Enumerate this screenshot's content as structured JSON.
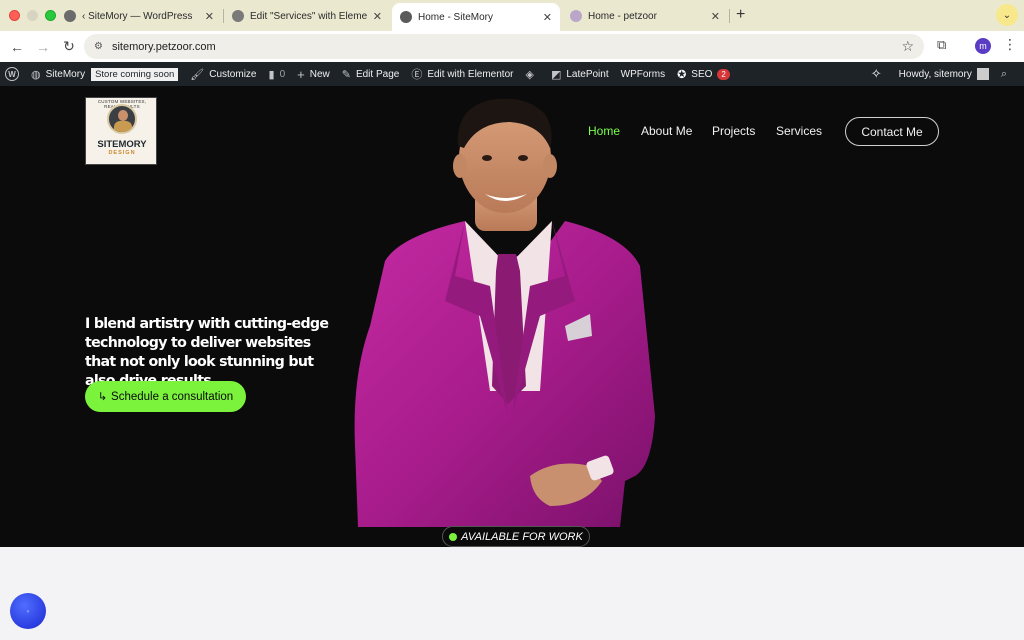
{
  "browser": {
    "tabs": [
      {
        "title": "‹ SiteMory — WordPress",
        "active": false
      },
      {
        "title": "Edit \"Services\" with Elemento",
        "active": false
      },
      {
        "title": "Home - SiteMory",
        "active": true
      },
      {
        "title": "Home - petzoor",
        "active": false
      }
    ],
    "new_tab": "+",
    "tab_menu_icon": "chevron-down-icon",
    "url": "sitemory.petzoor.com",
    "profile_initial": "m"
  },
  "wpbar": {
    "logo": "W",
    "site_name": "SiteMory",
    "store_badge": "Store coming soon",
    "customize": "Customize",
    "comments_count": "0",
    "new": "New",
    "edit_page": "Edit Page",
    "edit_elementor": "Edit with Elementor",
    "latepoint": "LatePoint",
    "wpforms": "WPForms",
    "seo": "SEO",
    "seo_count": "2",
    "howdy": "Howdy, sitemory"
  },
  "site": {
    "logo": {
      "arc_text": "CUSTOM WEBSITES, REAL RESULTS",
      "name": "SITEMORY",
      "sub": "DESIGN"
    },
    "nav": {
      "home": "Home",
      "about": "About Me",
      "projects": "Projects",
      "services": "Services",
      "contact": "Contact Me"
    },
    "tagline": "I blend artistry with cutting-edge technology to deliver websites that not only look stunning but also drive results.",
    "cta_arrow": "↳",
    "cta_label": "Schedule a consultation",
    "available": "AVAILABLE FOR WORK"
  },
  "colors": {
    "accent_green": "#7bf33d",
    "hero_bg": "#0b0b0b",
    "suit": "#b0208f",
    "wp_bar": "#1d2327"
  }
}
